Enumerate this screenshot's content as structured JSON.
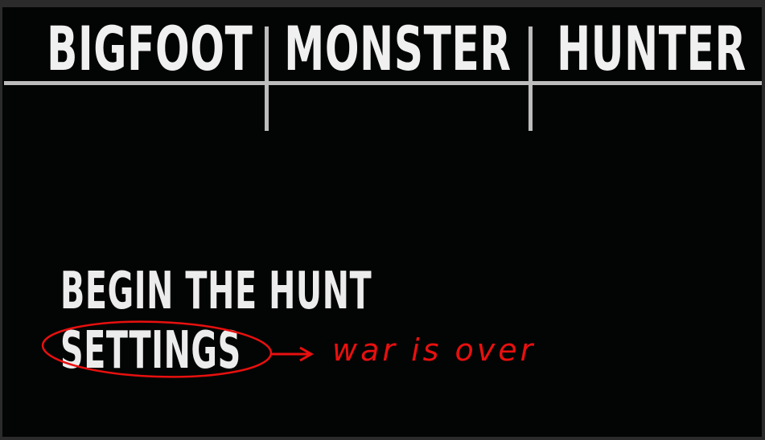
{
  "title": {
    "word1": "BIGFOOT",
    "word2": "MONSTER",
    "word3": "HUNTER"
  },
  "menu": {
    "items": [
      {
        "label": "BEGIN THE HUNT"
      },
      {
        "label": "SETTINGS"
      }
    ]
  },
  "annotation": {
    "text": "war  is over",
    "color": "#e8100f"
  },
  "colors": {
    "background": "#030504",
    "title_text": "#f0f0f0",
    "menu_text": "#ececec"
  }
}
